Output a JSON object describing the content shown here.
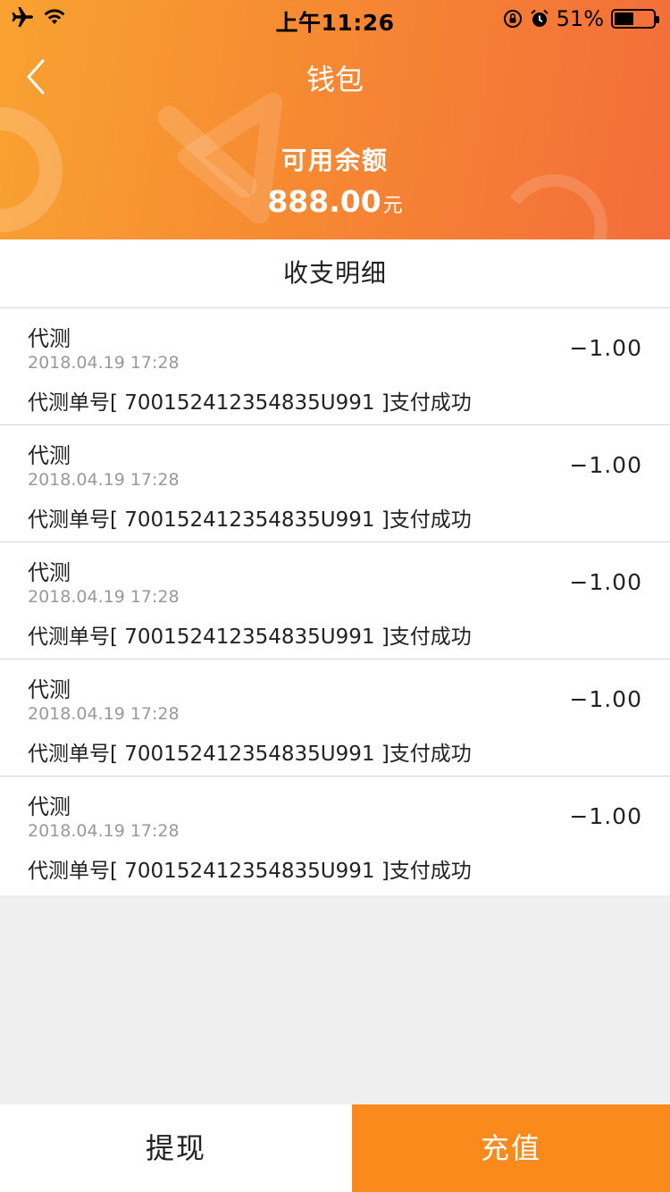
{
  "status_bar": {
    "time": "上午11:26",
    "battery": "51%",
    "battery_level": 0.51,
    "icons_left": [
      "airplane-icon",
      "wifi-icon"
    ],
    "icons_right": [
      "rotation-lock-icon",
      "alarm-icon",
      "battery-icon"
    ]
  },
  "header": {
    "title": "钱包",
    "back_icon": "chevron-left-icon",
    "balance_label": "可用余额",
    "balance_amount": "888.00",
    "balance_unit": "元"
  },
  "section": {
    "title": "收支明细"
  },
  "transactions": [
    {
      "title": "代测",
      "date": "2018.04.19 17:28",
      "desc": "代测单号[ 700152412354835U991 ]支付成功",
      "amount": "−1.00"
    },
    {
      "title": "代测",
      "date": "2018.04.19 17:28",
      "desc": "代测单号[ 700152412354835U991 ]支付成功",
      "amount": "−1.00"
    },
    {
      "title": "代测",
      "date": "2018.04.19 17:28",
      "desc": "代测单号[ 700152412354835U991 ]支付成功",
      "amount": "−1.00"
    },
    {
      "title": "代测",
      "date": "2018.04.19 17:28",
      "desc": "代测单号[ 700152412354835U991 ]支付成功",
      "amount": "−1.00"
    },
    {
      "title": "代测",
      "date": "2018.04.19 17:28",
      "desc": "代测单号[ 700152412354835U991 ]支付成功",
      "amount": "−1.00"
    }
  ],
  "actions": {
    "withdraw": "提现",
    "recharge": "充值"
  },
  "colors": {
    "header_start": "#f9a231",
    "header_end": "#f36d3a",
    "recharge_bg": "#fa8a1b",
    "page_bg": "#efefef"
  }
}
